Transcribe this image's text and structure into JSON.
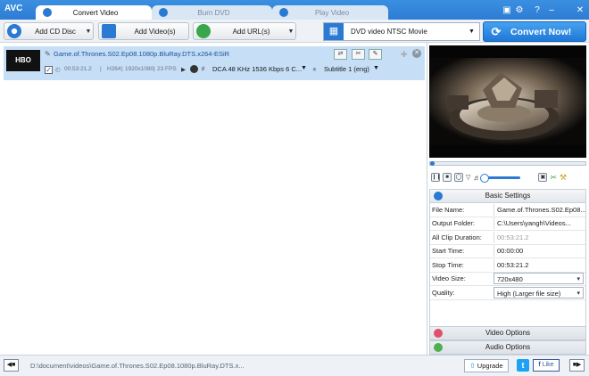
{
  "app": {
    "logo": "AVC"
  },
  "tabs": [
    {
      "label": "Convert Video",
      "icon": "convert-icon",
      "active": true
    },
    {
      "label": "Burn DVD",
      "icon": "disc-icon",
      "active": false
    },
    {
      "label": "Play Video",
      "icon": "play-icon",
      "active": false
    }
  ],
  "window_icons": [
    "skin-icon",
    "settings-icon",
    "help-icon",
    "minimize-icon",
    "close-icon"
  ],
  "toolbar": {
    "add_cd_label": "Add CD Disc",
    "add_videos_label": "Add Video(s)",
    "add_urls_label": "Add URL(s)",
    "profile_label": "DVD video NTSC Movie",
    "convert_label": "Convert Now!"
  },
  "file": {
    "thumb_text": "HBO",
    "name": "Game.of.Thrones.S02.Ep08.1080p.BluRay.DTS.x264-ESiR",
    "duration": "00:53:21.2",
    "codec": "H264",
    "resolution": "1920x1080",
    "fps": "23 FPS",
    "audio": "DCA 48 KHz 1536 Kbps 6 C...",
    "subtitle": "Subtitle 1 (eng)"
  },
  "settings": {
    "header": "Basic Settings",
    "rows": [
      {
        "key": "File Name:",
        "value": "Game.of.Thrones.S02.Ep08...",
        "style": "plain"
      },
      {
        "key": "Output Folder:",
        "value": "C:\\Users\\yangh\\Videos...",
        "style": "plain"
      },
      {
        "key": "All Clip Duration:",
        "value": "00:53:21.2",
        "style": "dim"
      },
      {
        "key": "Start Time:",
        "value": "00:00:00",
        "style": "plain"
      },
      {
        "key": "Stop Time:",
        "value": "00:53:21.2",
        "style": "plain"
      },
      {
        "key": "Video Size:",
        "value": "720x480",
        "style": "select"
      },
      {
        "key": "Quality:",
        "value": "High (Larger file size)",
        "style": "select"
      }
    ],
    "video_options": "Video Options",
    "audio_options": "Audio Options"
  },
  "status": {
    "path": "D:\\document\\videos\\Game.of.Thrones.S02.Ep08.1080p.BluRay.DTS.x...",
    "upgrade_label": "Upgrade",
    "twitter_label": "t",
    "like_label": "Like"
  },
  "colors": {
    "accent": "#2a79d2",
    "selection": "#c6def6"
  }
}
